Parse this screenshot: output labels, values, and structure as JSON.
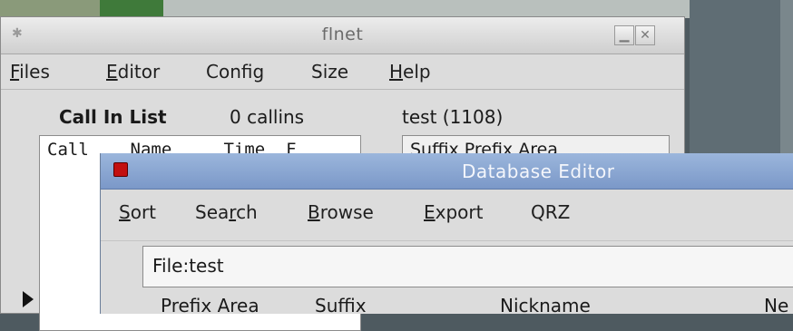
{
  "flnet_window": {
    "title": "flnet",
    "menu": [
      {
        "label": "Files",
        "mnemonic": "F",
        "rest": "iles"
      },
      {
        "label": "Editor",
        "mnemonic": "E",
        "rest": "ditor"
      },
      {
        "label": "Config"
      },
      {
        "label": "Size"
      },
      {
        "label": "Help",
        "mnemonic": "H",
        "rest": "elp"
      }
    ],
    "call_in_list_label": "Call In List",
    "callins_count": "0 callins",
    "net_label": "test (1108)",
    "call_list_headers": "Call    Name     Time  F",
    "suffix_box_text": "Suffix Prefix Area"
  },
  "db_editor_window": {
    "title": "Database Editor",
    "menu": [
      {
        "label": "Sort",
        "mnemonic": "S",
        "rest": "ort"
      },
      {
        "label": "Search",
        "before": "Sea",
        "mnemonic": "r",
        "rest": "ch"
      },
      {
        "label": "Browse",
        "mnemonic": "B",
        "rest": "rowse"
      },
      {
        "label": "Export",
        "mnemonic": "E",
        "rest": "xport"
      },
      {
        "label": "QRZ"
      }
    ],
    "file_label": "File:test",
    "columns": [
      "Prefix Area",
      "Suffix",
      "Nickname",
      "Ne"
    ]
  },
  "icons": {
    "flnet_app": "app-icon",
    "minimize": "minimize-icon",
    "close": "close-icon",
    "db_app": "database-icon",
    "row_marker": "arrow-right-icon"
  }
}
